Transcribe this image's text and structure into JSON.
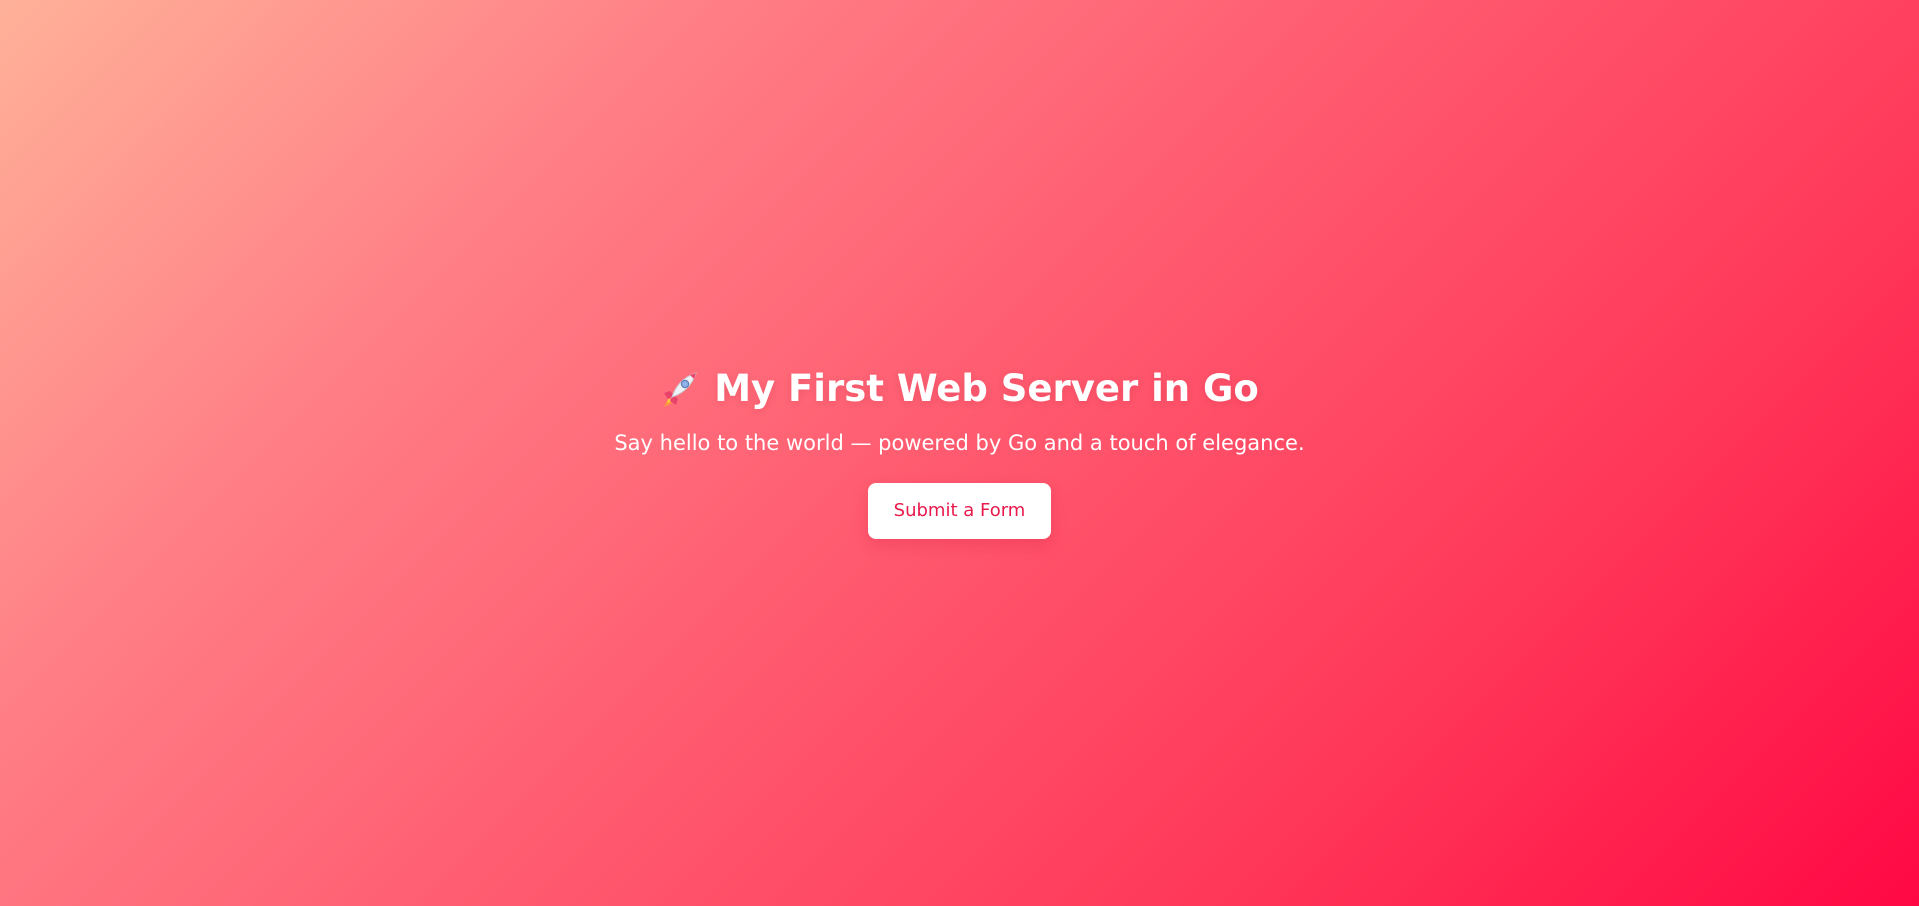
{
  "hero": {
    "icon": "rocket-icon",
    "title": "My First Web Server in Go",
    "subtitle": "Say hello to the world — powered by Go and a touch of elegance.",
    "button_label": "Submit a Form"
  },
  "colors": {
    "gradient_start": "#ffb199",
    "gradient_end": "#ff0844",
    "button_text": "#e8194b",
    "button_bg": "#ffffff",
    "text": "#ffffff"
  }
}
